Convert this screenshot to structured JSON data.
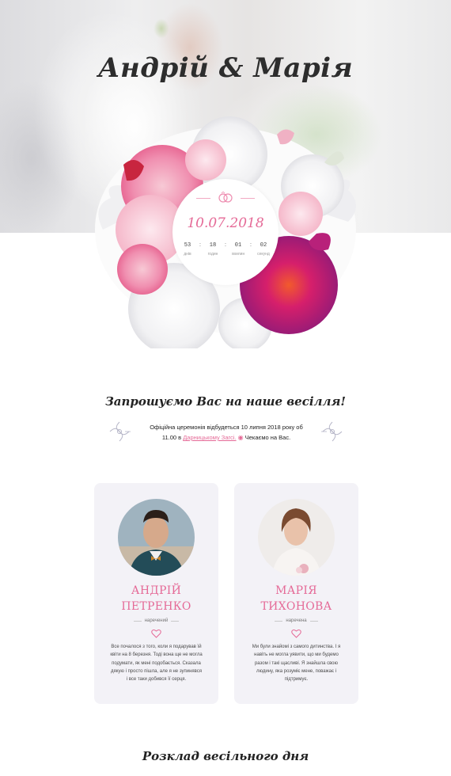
{
  "hero": {
    "couple": "Андрій & Марія"
  },
  "countdown": {
    "date": "10.07.2018",
    "units": [
      {
        "value": "53",
        "label": "днів"
      },
      {
        "value": "18",
        "label": "годин"
      },
      {
        "value": "01",
        "label": "хвилин"
      },
      {
        "value": "02",
        "label": "секунд"
      }
    ],
    "separator": ":"
  },
  "invitation": {
    "title": "Запрошуємо Вас на наше весілля!",
    "line1": "Офіційна церемонія відбудеться 10 липня 2018 року об",
    "line2_prefix": "11.00 в ",
    "venue_link": "Дарницькому Загсі.",
    "line2_suffix": " Чекаємо на Вас."
  },
  "groom": {
    "name_line1": "АНДРІЙ",
    "name_line2": "ПЕТРЕНКО",
    "role": "наречений",
    "story": "Все почалося з того, коли я подарував їй квіти на 8 березня. Тоді вона ще не могла подумати, як мені подобається. Сказала дякую і просто пішла, але я не зупинявся і все таки добився її серця."
  },
  "bride": {
    "name_line1": "МАРІЯ",
    "name_line2": "ТИХОНОВА",
    "role": "наречена",
    "story": "Ми були знайомі з самого дитинства. І я навіть не могла уявити, що ми будемо разом і такі щасливі. Я знайшла свою людину, яка розуміє мене, поважає і підтримує."
  },
  "schedule": {
    "title": "Розклад весільного дня"
  },
  "colors": {
    "accent": "#e56a97",
    "card_bg": "#f3f2f7"
  }
}
